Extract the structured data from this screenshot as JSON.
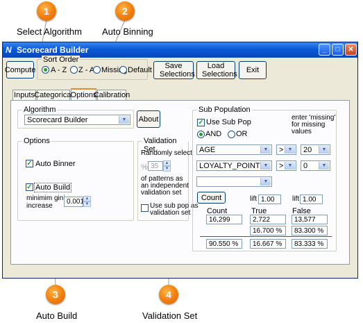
{
  "callouts": [
    {
      "number": "1",
      "label": "Select Algorithm"
    },
    {
      "number": "2",
      "label": "Auto Binning"
    },
    {
      "number": "3",
      "label": "Auto Build"
    },
    {
      "number": "4",
      "label": "Validation Set"
    }
  ],
  "window": {
    "title": "Scorecard Builder",
    "controls": {
      "minimize": "_",
      "maximize": "□",
      "close": "✕"
    }
  },
  "toolbar": {
    "compute": "Compute",
    "sort_order_label": "Sort Order",
    "sort_options": [
      "A - Z",
      "Z - A",
      "Missing",
      "Default"
    ],
    "save_selections": "Save Selections",
    "load_selections": "Load Selections",
    "exit": "Exit"
  },
  "tabs": [
    "Inputs",
    "Categorical",
    "Options",
    "Calibration"
  ],
  "algorithm": {
    "group_label": "Algorithm",
    "selected": "Scorecard Builder",
    "about": "About"
  },
  "options": {
    "group_label": "Options",
    "auto_binner": "Auto Binner",
    "auto_build": "Auto Build",
    "min_gini_label_1": "minimim gini",
    "min_gini_label_2": "increase",
    "min_gini_value": "0.001"
  },
  "validation": {
    "group_label": "Validation Set",
    "randomly_select": "Randomly select",
    "percent_symbol": "%",
    "percent_value": "35",
    "patterns_text_1": "of patterns as",
    "patterns_text_2": "an independent",
    "patterns_text_3": "validation set",
    "use_sub_pop_1": "Use sub pop as",
    "use_sub_pop_2": "validation set"
  },
  "sub_population": {
    "group_label": "Sub Population",
    "use_sub_pop": "Use Sub Pop",
    "and_label": "AND",
    "or_label": "OR",
    "hint_1": "enter 'missing'",
    "hint_2": "for missing",
    "hint_3": "values",
    "conditions": [
      {
        "variable": "AGE",
        "operator": ">",
        "value": "20"
      },
      {
        "variable": "LOYALTY_POINTS",
        "operator": ">",
        "value": "0"
      }
    ],
    "count_button": "Count",
    "lift_label": "lift",
    "lift_true": "1.00",
    "lift_false": "1.00",
    "col_count": "Count",
    "col_true": "True",
    "col_false": "False",
    "count_value": "16,299",
    "true_count": "2,722",
    "false_count": "13,577",
    "true_pct": "16.700 %",
    "false_pct": "83.300 %",
    "total_pct": "90.550 %",
    "true_pct_total": "16.667 %",
    "false_pct_total": "83.333 %"
  }
}
